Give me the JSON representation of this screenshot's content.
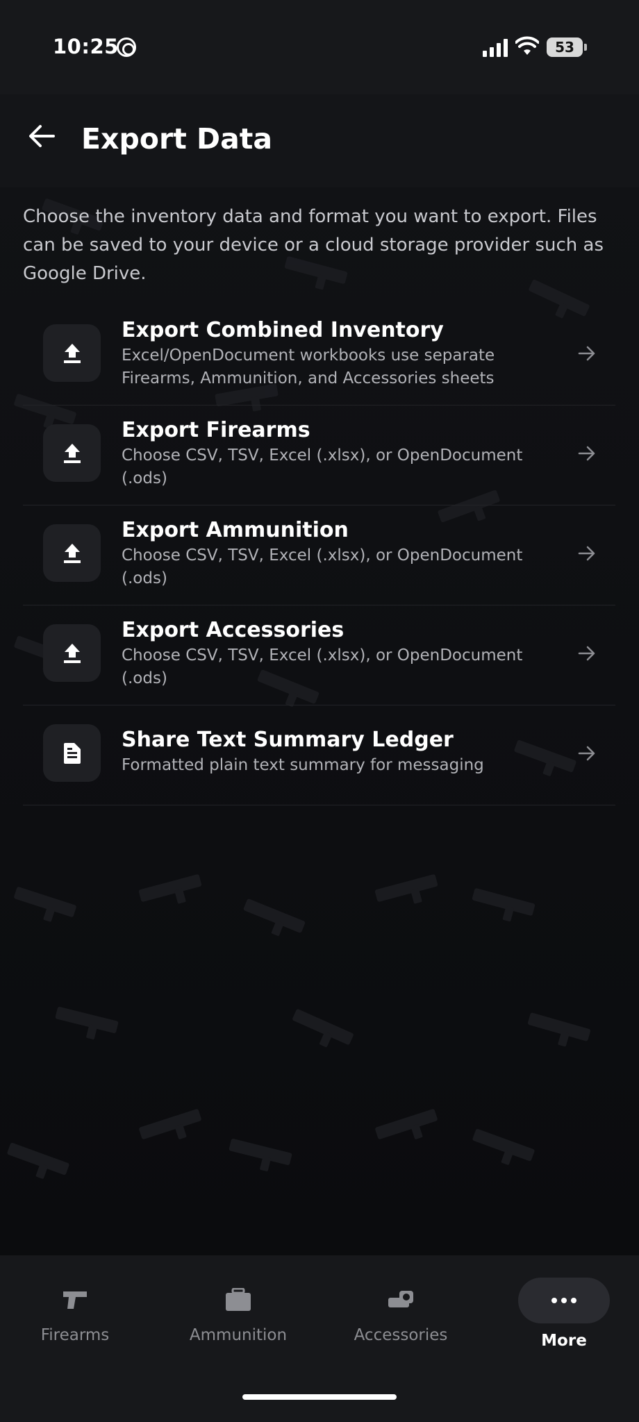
{
  "status_bar": {
    "time": "10:25",
    "battery": "53"
  },
  "header": {
    "title": "Export Data"
  },
  "description": "Choose the inventory data and format you want to export. Files can be saved to your device or a cloud storage provider such as Google Drive.",
  "export_options": [
    {
      "title": "Export Combined Inventory",
      "subtitle": "Excel/OpenDocument workbooks use separate Firearms, Ammunition, and Accessories sheets",
      "icon": "upload-icon"
    },
    {
      "title": "Export Firearms",
      "subtitle": "Choose CSV, TSV, Excel (.xlsx), or OpenDocument (.ods)",
      "icon": "upload-icon"
    },
    {
      "title": "Export Ammunition",
      "subtitle": "Choose CSV, TSV, Excel (.xlsx), or OpenDocument (.ods)",
      "icon": "upload-icon"
    },
    {
      "title": "Export Accessories",
      "subtitle": "Choose CSV, TSV, Excel (.xlsx), or OpenDocument (.ods)",
      "icon": "upload-icon"
    },
    {
      "title": "Share Text Summary Ledger",
      "subtitle": "Formatted plain text summary for messaging",
      "icon": "document-icon"
    }
  ],
  "bottom_nav": {
    "items": [
      {
        "label": "Firearms",
        "icon": "pistol-icon"
      },
      {
        "label": "Ammunition",
        "icon": "ammo-box-icon"
      },
      {
        "label": "Accessories",
        "icon": "optic-icon"
      },
      {
        "label": "More",
        "icon": "more-icon",
        "active": true
      }
    ]
  },
  "colors": {
    "background": "#0e0f12",
    "surface": "#17181b",
    "icon_tile": "#1f2024",
    "text_primary": "#ffffff",
    "text_secondary": "#b2b3b8"
  }
}
